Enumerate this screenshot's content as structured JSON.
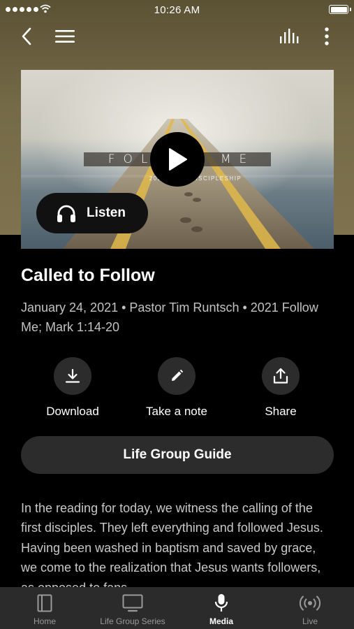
{
  "status_bar": {
    "time": "10:26 AM"
  },
  "hero": {
    "art_title": "FOLLOW ME",
    "art_subtitle": "2021 | A ... DISCIPLESHIP",
    "listen_label": "Listen"
  },
  "sermon": {
    "title": "Called to Follow",
    "meta": "January 24, 2021 • Pastor Tim Runtsch • 2021 Follow Me; Mark 1:14-20"
  },
  "actions": {
    "download": "Download",
    "note": "Take a note",
    "share": "Share"
  },
  "guide_button": "Life Group Guide",
  "description": "In the reading for today, we witness the calling of the first disciples. They left everything and followed Jesus. Having been washed in baptism and saved by grace, we come to the realization that Jesus wants followers, as opposed to fans.",
  "tabs": [
    {
      "label": "Home",
      "icon": "book-icon",
      "active": false
    },
    {
      "label": "Life Group Series",
      "icon": "tv-icon",
      "active": false
    },
    {
      "label": "Media",
      "icon": "microphone-icon",
      "active": true
    },
    {
      "label": "Live",
      "icon": "broadcast-icon",
      "active": false
    }
  ],
  "colors": {
    "header_bg": "#756a47",
    "page_bg": "#000000",
    "tabbar_bg": "#2b2b2b",
    "button_bg": "#2c2c2c",
    "active_tab": "#ffffff",
    "inactive_tab": "#9a9a9a"
  }
}
